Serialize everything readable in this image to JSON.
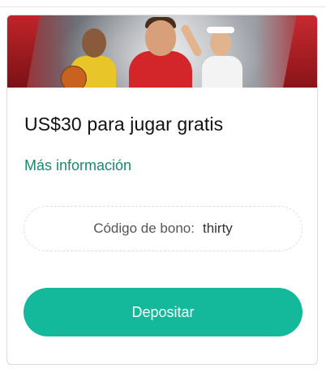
{
  "offer": {
    "title": "US$30 para jugar gratis",
    "more_info_link": "Más información",
    "bonus_label": "Código de bono:",
    "bonus_code": "thirty",
    "deposit_button": "Depositar"
  },
  "colors": {
    "accent": "#13b99a",
    "link": "#1a8a6e",
    "card_border": "#dcdcdc"
  },
  "hero": {
    "image": "sports-athletes-banner"
  }
}
